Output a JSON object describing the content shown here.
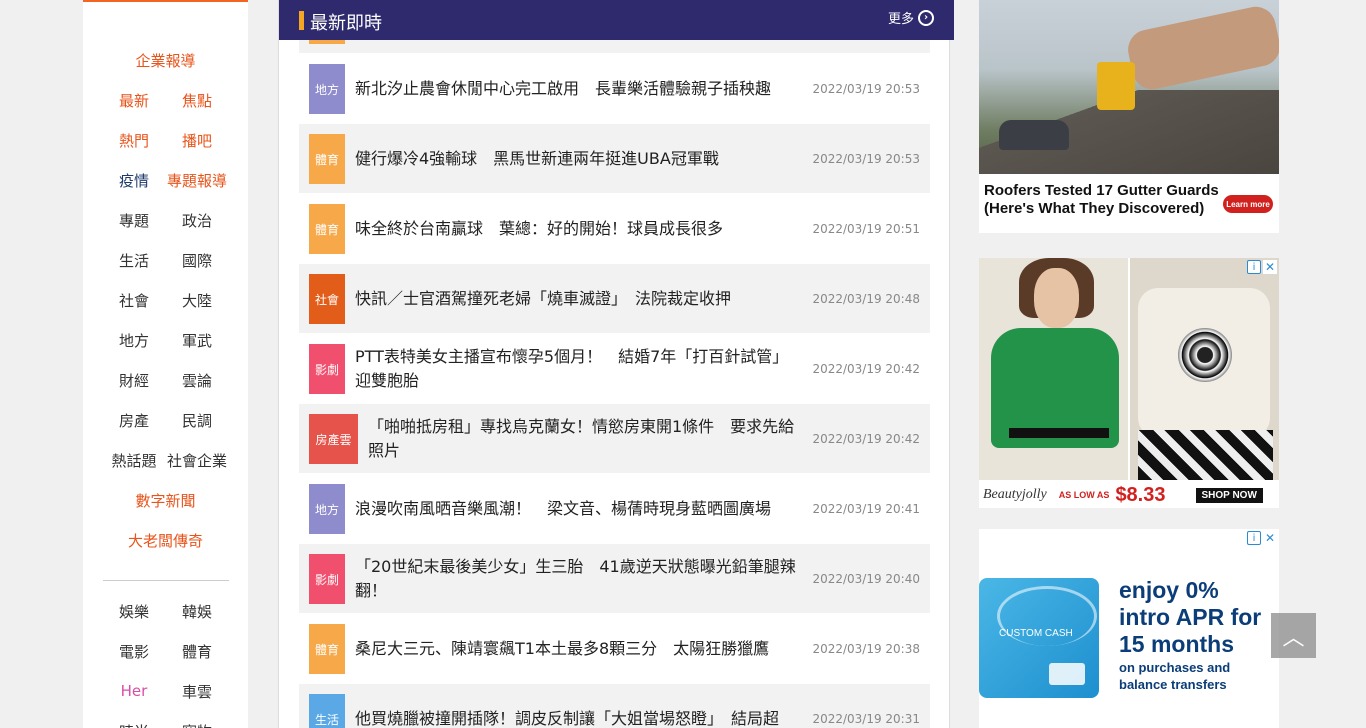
{
  "leftnav": {
    "rows": [
      [
        {
          "label": "企業報導",
          "style": "orange"
        }
      ],
      [
        {
          "label": "最新",
          "style": "orange"
        },
        {
          "label": "焦點",
          "style": "orange"
        }
      ],
      [
        {
          "label": "熱門",
          "style": "orange"
        },
        {
          "label": "播吧",
          "style": "orange"
        }
      ],
      [
        {
          "label": "疫情",
          "style": "navy"
        },
        {
          "label": "專題報導",
          "style": "orange"
        }
      ],
      [
        {
          "label": "專題",
          "style": ""
        },
        {
          "label": "政治",
          "style": ""
        }
      ],
      [
        {
          "label": "生活",
          "style": ""
        },
        {
          "label": "國際",
          "style": ""
        }
      ],
      [
        {
          "label": "社會",
          "style": ""
        },
        {
          "label": "大陸",
          "style": ""
        }
      ],
      [
        {
          "label": "地方",
          "style": ""
        },
        {
          "label": "軍武",
          "style": ""
        }
      ],
      [
        {
          "label": "財經",
          "style": ""
        },
        {
          "label": "雲論",
          "style": ""
        }
      ],
      [
        {
          "label": "房產",
          "style": ""
        },
        {
          "label": "民調",
          "style": ""
        }
      ],
      [
        {
          "label": "熱話題",
          "style": ""
        },
        {
          "label": "社會企業",
          "style": ""
        }
      ],
      [
        {
          "label": "數字新聞",
          "style": "orange"
        }
      ],
      [
        {
          "label": "大老闆傳奇",
          "style": "orange"
        }
      ]
    ],
    "rows2": [
      [
        {
          "label": "娛樂",
          "style": ""
        },
        {
          "label": "韓娛",
          "style": ""
        }
      ],
      [
        {
          "label": "電影",
          "style": ""
        },
        {
          "label": "體育",
          "style": ""
        }
      ],
      [
        {
          "label": "Her",
          "style": "pink"
        },
        {
          "label": "車雲",
          "style": ""
        }
      ],
      [
        {
          "label": "時尚",
          "style": ""
        },
        {
          "label": "寵物",
          "style": ""
        }
      ]
    ]
  },
  "header": {
    "title": "最新即時",
    "more": "更多"
  },
  "news": [
    {
      "category": "",
      "color": "#f7a94a",
      "title": "",
      "time": ""
    },
    {
      "category": "地方",
      "color": "#8e8ccc",
      "title": "新北汐止農會休閒中心完工啟用　長輩樂活體驗親子插秧趣",
      "time": "2022/03/19 20:53"
    },
    {
      "category": "體育",
      "color": "#f7a94a",
      "title": "健行爆冷4強輸球　黑馬世新連兩年挺進UBA冠軍戰",
      "time": "2022/03/19 20:53"
    },
    {
      "category": "體育",
      "color": "#f7a94a",
      "title": "味全終於台南贏球　葉總：好的開始！球員成長很多",
      "time": "2022/03/19 20:51"
    },
    {
      "category": "社會",
      "color": "#e35d1a",
      "title": "快訊／士官酒駕撞死老婦「燒車滅證」　法院裁定收押",
      "time": "2022/03/19 20:48"
    },
    {
      "category": "影劇",
      "color": "#f0506e",
      "title": "PTT表特美女主播宣布懷孕5個月！　結婚7年「打百針試管」迎雙胞胎",
      "time": "2022/03/19 20:42"
    },
    {
      "category": "房產雲",
      "color": "#e5534b",
      "title": "「啪啪抵房租」專找烏克蘭女！情慾房東開1條件　要求先給照片",
      "time": "2022/03/19 20:42"
    },
    {
      "category": "地方",
      "color": "#8e8ccc",
      "title": "浪漫吹南風晒音樂風潮！　梁文音、楊蒨時現身藍晒圖廣場",
      "time": "2022/03/19 20:41"
    },
    {
      "category": "影劇",
      "color": "#f0506e",
      "title": "「20世紀末最後美少女」生三胎　41歲逆天狀態曝光鉛筆腿辣翻！",
      "time": "2022/03/19 20:40"
    },
    {
      "category": "體育",
      "color": "#f7a94a",
      "title": "桑尼大三元、陳靖寰飆T1本土最多8顆三分　太陽狂勝獵鷹",
      "time": "2022/03/19 20:38"
    },
    {
      "category": "生活",
      "color": "#5aa9e6",
      "title": "他買燒臘被撞開插隊！調皮反制讓「大姐當場怒瞪」　結局超",
      "time": "2022/03/19 20:31"
    }
  ],
  "ads": {
    "ad1": {
      "caption": "Roofers Tested 17 Gutter Guards (Here's What They Discovered)",
      "cta": "Learn more"
    },
    "ad2": {
      "brand": "Beautyjolly",
      "low": "AS LOW AS",
      "price": "$8.33",
      "cta": "SHOP NOW"
    },
    "ad3": {
      "card_name": "CUSTOM CASH",
      "headline": "enjoy 0% intro APR for 15 months",
      "sub": "on purchases and balance transfers"
    }
  },
  "totop": {
    "icon": "chevron-up-icon"
  }
}
